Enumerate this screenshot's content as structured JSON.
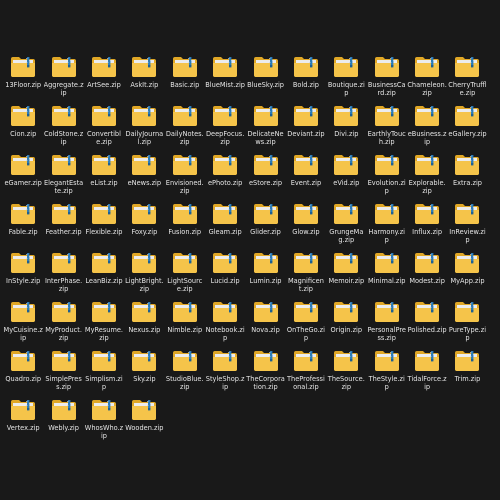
{
  "icon": "zip-folder-icon",
  "colors": {
    "folder": "#f5c44a",
    "folder_back": "#e0a726",
    "zipper": "#2b7bb8",
    "background": "#191919",
    "text": "#e6e6e6"
  },
  "files": [
    "13Floor.zip",
    "Aggregate.zip",
    "ArtSee.zip",
    "AskIt.zip",
    "Basic.zip",
    "BlueMist.zip",
    "BlueSky.zip",
    "Bold.zip",
    "Boutique.zip",
    "BusinessCard.zip",
    "Chameleon.zip",
    "CherryTruffle.zip",
    "Cion.zip",
    "ColdStone.zip",
    "Convertible.zip",
    "DailyJournal.zip",
    "DailyNotes.zip",
    "DeepFocus.zip",
    "DelicateNews.zip",
    "Deviant.zip",
    "Divi.zip",
    "EarthlyTouch.zip",
    "eBusiness.zip",
    "eGallery.zip",
    "eGamer.zip",
    "ElegantEstate.zip",
    "eList.zip",
    "eNews.zip",
    "Envisioned.zip",
    "ePhoto.zip",
    "eStore.zip",
    "Event.zip",
    "eVid.zip",
    "Evolution.zip",
    "Explorable.zip",
    "Extra.zip",
    "Fable.zip",
    "Feather.zip",
    "Flexible.zip",
    "Foxy.zip",
    "Fusion.zip",
    "Gleam.zip",
    "Glider.zip",
    "Glow.zip",
    "GrungeMag.zip",
    "Harmony.zip",
    "Influx.zip",
    "InReview.zip",
    "InStyle.zip",
    "InterPhase.zip",
    "LeanBiz.zip",
    "LightBright.zip",
    "LightSource.zip",
    "Lucid.zip",
    "Lumin.zip",
    "Magnificent.zip",
    "Memoir.zip",
    "Minimal.zip",
    "Modest.zip",
    "MyApp.zip",
    "MyCuisine.zip",
    "MyProduct.zip",
    "MyResume.zip",
    "Nexus.zip",
    "Nimble.zip",
    "Notebook.zip",
    "Nova.zip",
    "OnTheGo.zip",
    "Origin.zip",
    "PersonalPress.zip",
    "Polished.zip",
    "PureType.zip",
    "Quadro.zip",
    "SimplePress.zip",
    "Simplism.zip",
    "Sky.zip",
    "StudioBlue.zip",
    "StyleShop.zip",
    "TheCorporation.zip",
    "TheProfessional.zip",
    "TheSource.zip",
    "TheStyle.zip",
    "TidalForce.zip",
    "Trim.zip",
    "Vertex.zip",
    "Webly.zip",
    "WhosWho.zip",
    "Wooden.zip"
  ]
}
